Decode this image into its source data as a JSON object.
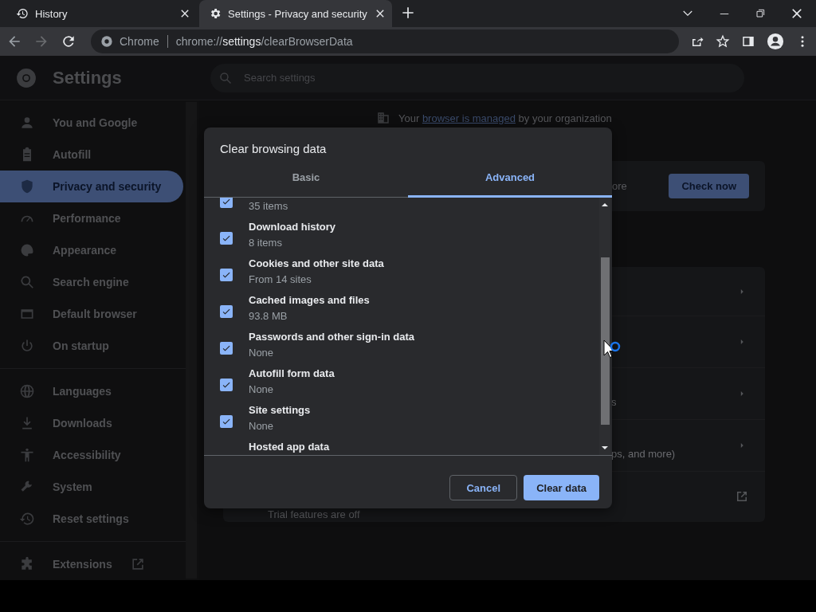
{
  "tabs": [
    {
      "title": "History",
      "selected": false
    },
    {
      "title": "Settings - Privacy and security",
      "selected": true
    }
  ],
  "toolbar": {
    "forward_disabled": true,
    "chip": "Chrome",
    "url": {
      "scheme": "chrome://",
      "host": "settings",
      "path": "/clearBrowserData"
    }
  },
  "settings_header": {
    "title": "Settings",
    "search": {
      "placeholder": "Search settings"
    }
  },
  "sidebar": {
    "sections": [
      [
        {
          "label": "You and Google",
          "selected": false
        },
        {
          "label": "Autofill",
          "selected": false
        },
        {
          "label": "Privacy and security",
          "selected": true
        },
        {
          "label": "Performance",
          "selected": false
        },
        {
          "label": "Appearance",
          "selected": false
        },
        {
          "label": "Search engine",
          "selected": false
        },
        {
          "label": "Default browser",
          "selected": false
        },
        {
          "label": "On startup",
          "selected": false
        }
      ],
      [
        {
          "label": "Languages",
          "selected": false
        },
        {
          "label": "Downloads",
          "selected": false
        },
        {
          "label": "Accessibility",
          "selected": false
        },
        {
          "label": "System",
          "selected": false
        },
        {
          "label": "Reset settings",
          "selected": false
        }
      ]
    ],
    "extensions": {
      "label": "Extensions"
    }
  },
  "managed_notice": {
    "before": "Your ",
    "link": "browser is managed",
    "after": " by your organization"
  },
  "safety_card": {
    "text": "ore",
    "button": "Check now"
  },
  "privacy_rows": [
    {
      "text": ""
    },
    {
      "text": ""
    },
    {
      "text": "s"
    },
    {
      "text": "ps, and more)"
    }
  ],
  "trial_row": {
    "subtitle": "Trial features are off"
  },
  "dialog": {
    "title": "Clear browsing data",
    "tabs": [
      {
        "label": "Basic",
        "selected": false
      },
      {
        "label": "Advanced",
        "selected": true
      }
    ],
    "items": [
      {
        "subtitle": "35 items",
        "checked": true
      },
      {
        "title": "Download history",
        "subtitle": "8 items",
        "checked": true
      },
      {
        "title": "Cookies and other site data",
        "subtitle": "From 14 sites",
        "checked": true
      },
      {
        "title": "Cached images and files",
        "subtitle": "93.8 MB",
        "checked": true
      },
      {
        "title": "Passwords and other sign-in data",
        "subtitle": "None",
        "checked": true
      },
      {
        "title": "Autofill form data",
        "subtitle": "None",
        "checked": true
      },
      {
        "title": "Site settings",
        "subtitle": "None",
        "checked": true
      },
      {
        "title": "Hosted app data"
      }
    ],
    "buttons": {
      "cancel": "Cancel",
      "confirm": "Clear data"
    }
  }
}
